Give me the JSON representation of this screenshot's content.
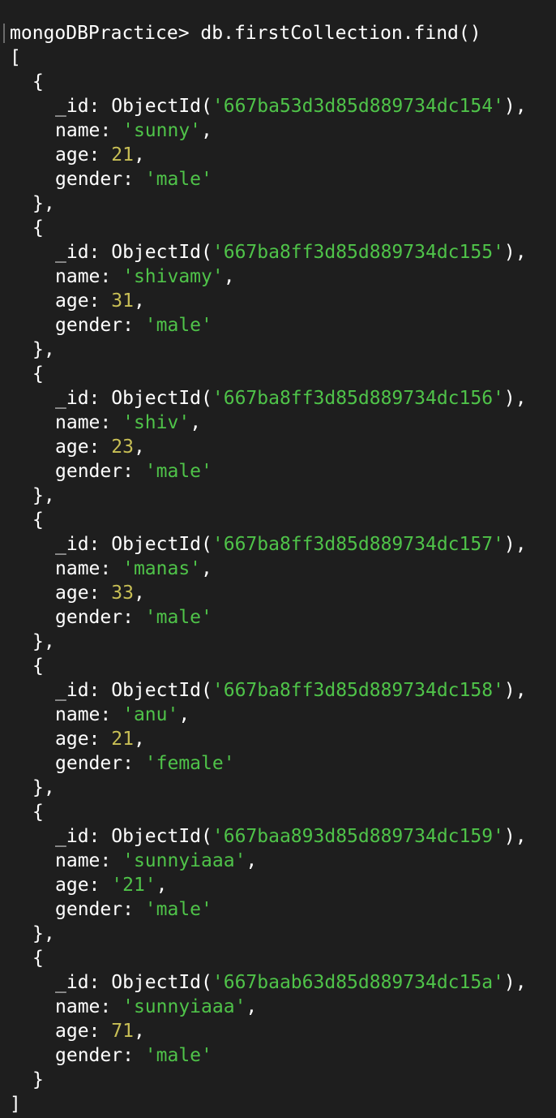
{
  "terminal": {
    "prompt": "mongoDBPractice>",
    "command": "db.firstCollection.find()",
    "open_bracket": "[",
    "close_bracket": "]"
  },
  "documents": [
    {
      "_id": "'667ba53d3d85d889734dc154'",
      "name": "'sunny'",
      "age": "21",
      "age_is_string": false,
      "gender": "'male'"
    },
    {
      "_id": "'667ba8ff3d85d889734dc155'",
      "name": "'shivamy'",
      "age": "31",
      "age_is_string": false,
      "gender": "'male'"
    },
    {
      "_id": "'667ba8ff3d85d889734dc156'",
      "name": "'shiv'",
      "age": "23",
      "age_is_string": false,
      "gender": "'male'"
    },
    {
      "_id": "'667ba8ff3d85d889734dc157'",
      "name": "'manas'",
      "age": "33",
      "age_is_string": false,
      "gender": "'male'"
    },
    {
      "_id": "'667ba8ff3d85d889734dc158'",
      "name": "'anu'",
      "age": "21",
      "age_is_string": false,
      "gender": "'female'"
    },
    {
      "_id": "'667baa893d85d889734dc159'",
      "name": "'sunnyiaaa'",
      "age": "'21'",
      "age_is_string": true,
      "gender": "'male'"
    },
    {
      "_id": "'667baab63d85d889734dc15a'",
      "name": "'sunnyiaaa'",
      "age": "71",
      "age_is_string": false,
      "gender": "'male'"
    }
  ],
  "colors": {
    "background": "#1e1e1e",
    "text": "#ffffff",
    "string": "#4fc349",
    "number": "#c8bf55"
  }
}
